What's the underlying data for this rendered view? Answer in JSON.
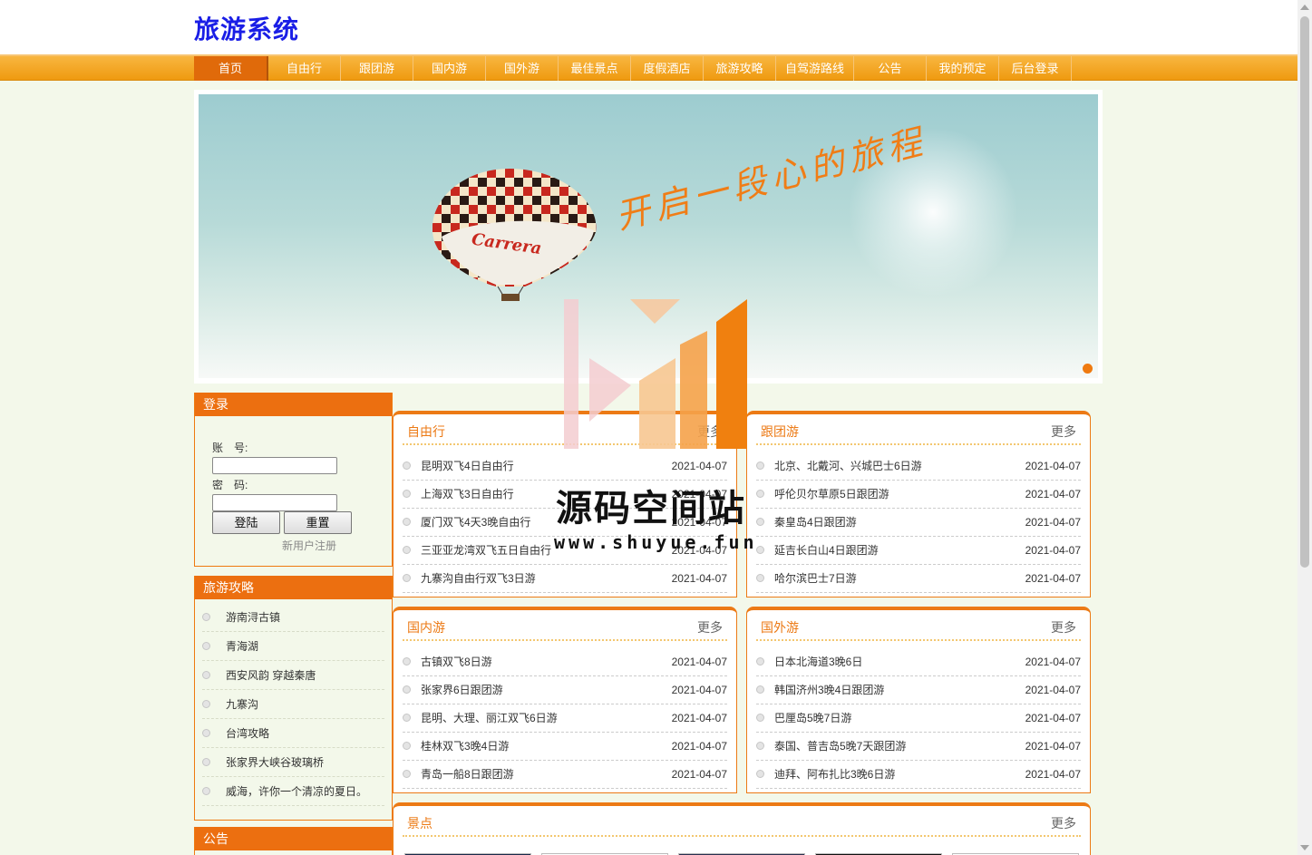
{
  "site": {
    "title": "旅游系统"
  },
  "nav": [
    "首页",
    "自由行",
    "跟团游",
    "国内游",
    "国外游",
    "最佳景点",
    "度假酒店",
    "旅游攻略",
    "自驾游路线",
    "公告",
    "我的预定",
    "后台登录"
  ],
  "banner": {
    "slogan": "开启一段心的旅程",
    "balloon_text": "Carrera"
  },
  "login": {
    "title": "登录",
    "account_label": "账　号:",
    "password_label": "密　码:",
    "account_value": "",
    "password_value": "",
    "login_button": "登陆",
    "reset_button": "重置",
    "register_link": "新用户注册"
  },
  "guides": {
    "title": "旅游攻略",
    "items": [
      "游南浔古镇",
      "青海湖",
      "西安风韵 穿越秦唐",
      "九寨沟",
      "台湾攻略",
      "张家界大峡谷玻璃桥",
      "威海，许你一个清凉的夏日。"
    ]
  },
  "notice": {
    "title": "公告"
  },
  "panels": [
    {
      "title": "自由行",
      "more": "更多",
      "rows": [
        {
          "name": "昆明双飞4日自由行",
          "date": "2021-04-07"
        },
        {
          "name": "上海双飞3日自由行",
          "date": "2021-04-07"
        },
        {
          "name": "厦门双飞4天3晚自由行",
          "date": "2021-04-07"
        },
        {
          "name": "三亚亚龙湾双飞五日自由行",
          "date": "2021-04-07"
        },
        {
          "name": "九寨沟自由行双飞3日游",
          "date": "2021-04-07"
        }
      ]
    },
    {
      "title": "跟团游",
      "more": "更多",
      "rows": [
        {
          "name": "北京、北戴河、兴城巴士6日游",
          "date": "2021-04-07"
        },
        {
          "name": "呼伦贝尔草原5日跟团游",
          "date": "2021-04-07"
        },
        {
          "name": "秦皇岛4日跟团游",
          "date": "2021-04-07"
        },
        {
          "name": "延吉长白山4日跟团游",
          "date": "2021-04-07"
        },
        {
          "name": "哈尔滨巴士7日游",
          "date": "2021-04-07"
        }
      ]
    },
    {
      "title": "国内游",
      "more": "更多",
      "rows": [
        {
          "name": "古镇双飞8日游",
          "date": "2021-04-07"
        },
        {
          "name": "张家界6日跟团游",
          "date": "2021-04-07"
        },
        {
          "name": "昆明、大理、丽江双飞6日游",
          "date": "2021-04-07"
        },
        {
          "name": "桂林双飞3晚4日游",
          "date": "2021-04-07"
        },
        {
          "name": "青岛一船8日跟团游",
          "date": "2021-04-07"
        }
      ]
    },
    {
      "title": "国外游",
      "more": "更多",
      "rows": [
        {
          "name": "日本北海道3晚6日",
          "date": "2021-04-07"
        },
        {
          "name": "韩国济州3晚4日跟团游",
          "date": "2021-04-07"
        },
        {
          "name": "巴厘岛5晚7日游",
          "date": "2021-04-07"
        },
        {
          "name": "泰国、普吉岛5晚7天跟团游",
          "date": "2021-04-07"
        },
        {
          "name": "迪拜、阿布扎比3晚6日游",
          "date": "2021-04-07"
        }
      ]
    }
  ],
  "scenic": {
    "title": "景点",
    "more": "更多"
  },
  "watermark": {
    "name": "源码空间站",
    "url": "www.shuyue.fun"
  }
}
